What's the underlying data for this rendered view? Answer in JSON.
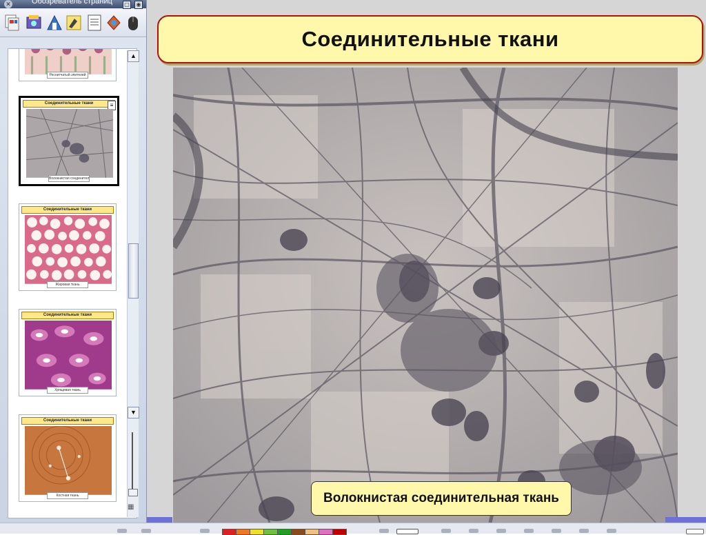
{
  "app": {
    "window_title": "Обозреватель страниц"
  },
  "page": {
    "title": "Соединительные ткани",
    "image_caption": "Волокнистая соединительная ткань"
  },
  "thumbnails": [
    {
      "header": "",
      "caption": "Реснитчатый эпителий",
      "selected": false
    },
    {
      "header": "Соединительные ткани",
      "caption": "Волокнистая соединительная ткань",
      "selected": true
    },
    {
      "header": "Соединительные ткани",
      "caption": "Жировая ткань",
      "selected": false
    },
    {
      "header": "Соединительные ткани",
      "caption": "Хрящевая ткань",
      "selected": false
    },
    {
      "header": "Соединительные ткани",
      "caption": "Костная ткань",
      "selected": false
    }
  ],
  "toolbar_icons": [
    "page-sorter-icon",
    "gallery-icon",
    "attachments-icon",
    "properties-icon",
    "notes-icon",
    "lesson-activity-icon",
    "mouse-settings-icon"
  ],
  "colors": {
    "title_fill": "#fff7aa",
    "title_border": "#b01010",
    "palette": [
      "#e02020",
      "#f07820",
      "#f0e020",
      "#70c040",
      "#20a020",
      "#8b4a1a",
      "#f0c080",
      "#e070c0",
      "#c00000"
    ]
  }
}
